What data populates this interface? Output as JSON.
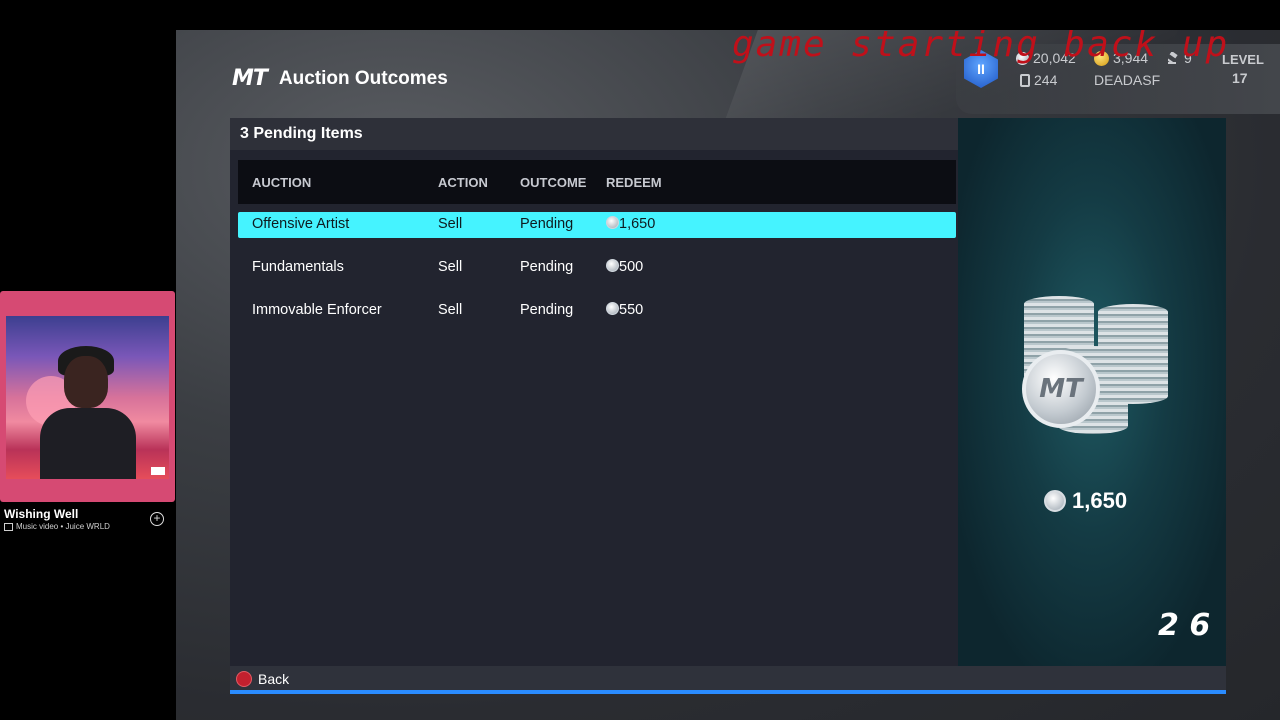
{
  "game": {
    "logo": "MT",
    "title": "Auction Outcomes",
    "overlay_text": "game starting back up",
    "hud": {
      "badge": "II",
      "mt_balance": "20,042",
      "vc_balance": "3,944",
      "auctions_count": "9",
      "cards_count": "244",
      "username": "DEADASF",
      "level_label": "LEVEL",
      "level_value": "17"
    },
    "panel": {
      "header": "3 Pending Items",
      "columns": [
        "AUCTION",
        "ACTION",
        "OUTCOME",
        "REDEEM"
      ],
      "rows": [
        {
          "auction": "Offensive Artist",
          "action": "Sell",
          "outcome": "Pending",
          "redeem": "1,650"
        },
        {
          "auction": "Fundamentals",
          "action": "Sell",
          "outcome": "Pending",
          "redeem": "500"
        },
        {
          "auction": "Immovable Enforcer",
          "action": "Sell",
          "outcome": "Pending",
          "redeem": "550"
        }
      ]
    },
    "side": {
      "coin_label": "MT",
      "amount": "1,650",
      "logo": "2 6"
    },
    "footer": {
      "back_label": "Back"
    }
  },
  "music": {
    "title": "Wishing Well",
    "subtitle": "Music video • Juice WRLD",
    "add_icon": "+"
  },
  "colors": {
    "selected_row": "#45f3ff",
    "accent_line": "#2a8cff",
    "overlay_red": "#c0101a",
    "music_card": "#d64a73"
  }
}
